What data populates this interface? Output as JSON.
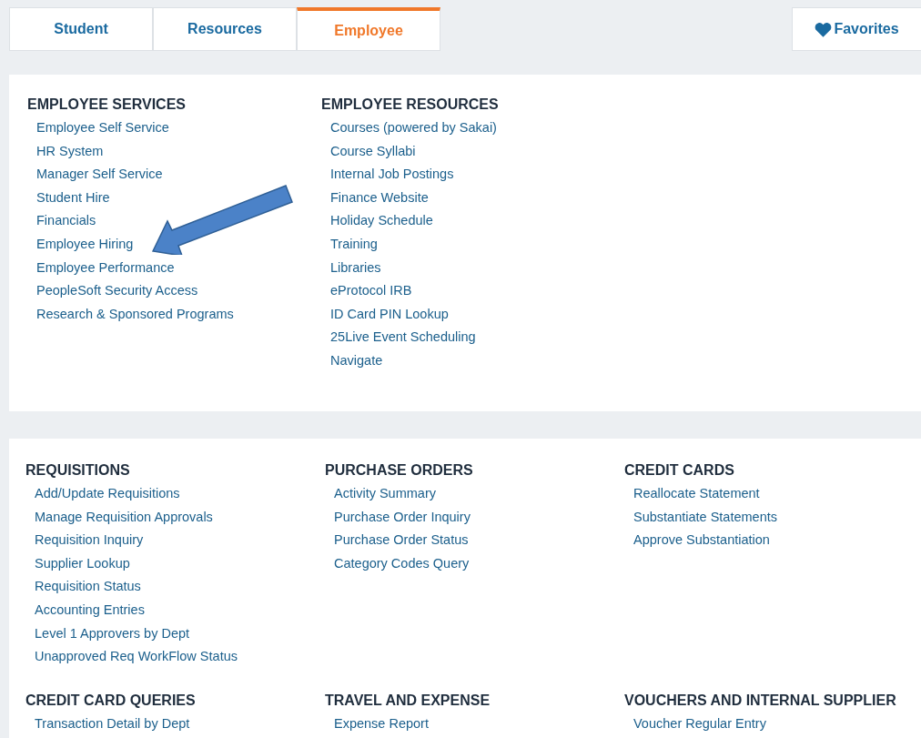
{
  "tabs": [
    {
      "label": "Student",
      "selected": false
    },
    {
      "label": "Resources",
      "selected": false
    },
    {
      "label": "Employee",
      "selected": true
    }
  ],
  "favorites": {
    "label": "Favorites"
  },
  "panels": [
    {
      "sections": [
        {
          "title": "EMPLOYEE SERVICES",
          "links": [
            "Employee Self Service",
            "HR System",
            "Manager Self Service",
            "Student Hire",
            "Financials",
            "Employee Hiring",
            "Employee Performance",
            "PeopleSoft Security Access",
            "Research & Sponsored Programs"
          ]
        },
        {
          "title": "EMPLOYEE RESOURCES",
          "links": [
            "Courses (powered by Sakai)",
            "Course Syllabi",
            "Internal Job Postings",
            "Finance Website",
            "Holiday Schedule",
            "Training",
            "Libraries",
            "eProtocol IRB",
            "ID Card PIN Lookup",
            "25Live Event Scheduling",
            "Navigate"
          ]
        }
      ]
    },
    {
      "sections": [
        {
          "title": "REQUISITIONS",
          "links": [
            "Add/Update Requisitions",
            "Manage Requisition Approvals",
            "Requisition Inquiry",
            "Supplier Lookup",
            "Requisition Status",
            "Accounting Entries",
            "Level 1 Approvers by Dept",
            "Unapproved Req WorkFlow Status"
          ]
        },
        {
          "title": "PURCHASE ORDERS",
          "links": [
            "Activity Summary",
            "Purchase Order Inquiry",
            "Purchase Order Status",
            "Category Codes Query"
          ]
        },
        {
          "title": "CREDIT CARDS",
          "links": [
            "Reallocate Statement",
            "Substantiate Statements",
            "Approve Substantiation"
          ]
        },
        {
          "title": "CREDIT CARD QUERIES",
          "links": [
            "Transaction Detail by Dept"
          ]
        },
        {
          "title": "TRAVEL AND EXPENSE",
          "links": [
            "Expense Report"
          ]
        },
        {
          "title": "VOUCHERS AND INTERNAL SUPPLIER",
          "links": [
            "Voucher Regular Entry"
          ]
        }
      ]
    }
  ]
}
